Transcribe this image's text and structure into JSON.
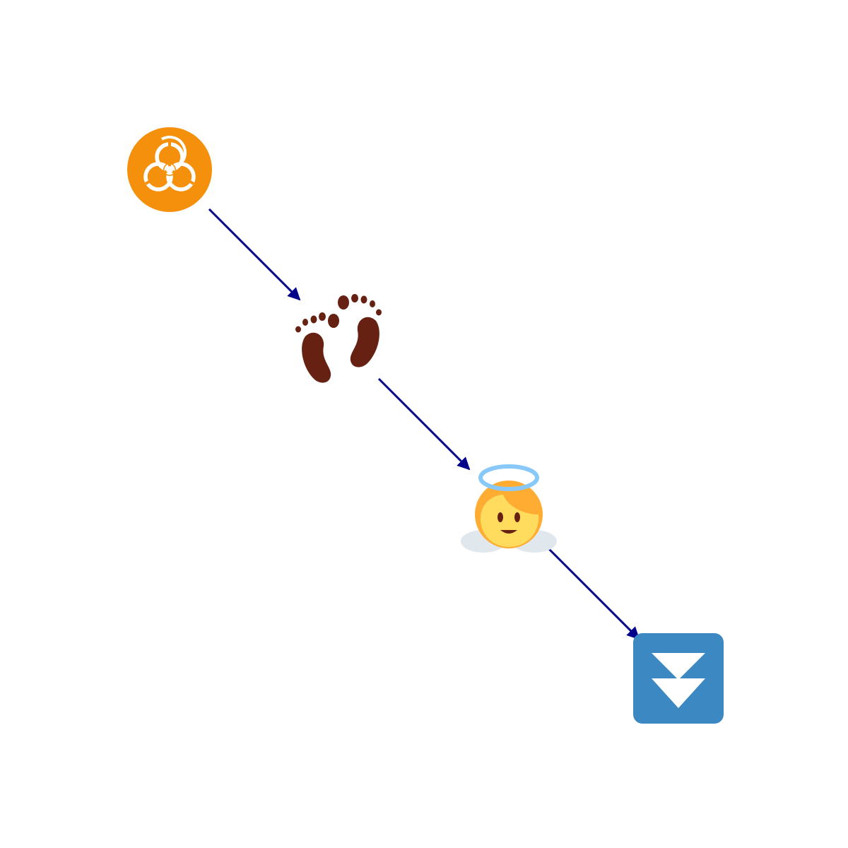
{
  "diagram": {
    "type": "flow",
    "direction": "diagonal-down-right",
    "nodes": [
      {
        "id": "n1",
        "icon": "biohazard-icon",
        "color": "#F4900C",
        "symbol_color": "#FFFFFF"
      },
      {
        "id": "n2",
        "icon": "footprints-icon",
        "color": "#662113"
      },
      {
        "id": "n3",
        "icon": "baby-angel-icon",
        "face_color": "#FFDC5D",
        "hair_color": "#FFAC33",
        "halo_color": "#88C9F9",
        "cloud_color": "#E1E8ED",
        "feature_color": "#662113"
      },
      {
        "id": "n4",
        "icon": "fast-down-button-icon",
        "color": "#3B88C3",
        "symbol_color": "#FFFFFF"
      }
    ],
    "edges": [
      {
        "from": "n1",
        "to": "n2"
      },
      {
        "from": "n2",
        "to": "n3"
      },
      {
        "from": "n3",
        "to": "n4"
      }
    ],
    "edge_color": "#00008B"
  }
}
